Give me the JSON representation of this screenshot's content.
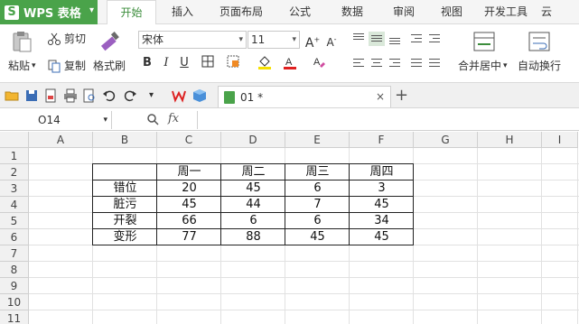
{
  "app": {
    "logo": "S",
    "name": "WPS 表格",
    "caret": "▾"
  },
  "menu": {
    "tabs": [
      {
        "label": "开始"
      },
      {
        "label": "插入"
      },
      {
        "label": "页面布局"
      },
      {
        "label": "公式"
      },
      {
        "label": "数据"
      },
      {
        "label": "审阅"
      },
      {
        "label": "视图"
      },
      {
        "label": "开发工具"
      },
      {
        "label": "云"
      }
    ]
  },
  "ribbon": {
    "paste": "粘贴",
    "cut": "剪切",
    "copy": "复制",
    "format_painter": "格式刷",
    "font_name": "宋体",
    "font_size": "11",
    "bold": "B",
    "italic": "I",
    "underline": "U",
    "merge_center": "合并居中",
    "wrap_text": "自动换行",
    "font_color": "#e02020",
    "fill_color": "#f5e000"
  },
  "quick_access": {
    "doc_tab": "01 *",
    "close": "×",
    "add": "+"
  },
  "formula_bar": {
    "cell_ref": "O14",
    "fx": "fx",
    "value": ""
  },
  "sheet": {
    "columns": [
      "A",
      "B",
      "C",
      "D",
      "E",
      "F",
      "G",
      "H",
      "I"
    ],
    "rows": [
      "1",
      "2",
      "3",
      "4",
      "5",
      "6",
      "7",
      "8",
      "9",
      "10",
      "11"
    ],
    "table": {
      "header": [
        "",
        "周一",
        "周二",
        "周三",
        "周四"
      ],
      "body": [
        [
          "错位",
          "20",
          "45",
          "6",
          "3"
        ],
        [
          "脏污",
          "45",
          "44",
          "7",
          "45"
        ],
        [
          "开裂",
          "66",
          "6",
          "6",
          "34"
        ],
        [
          "变形",
          "77",
          "88",
          "45",
          "45"
        ]
      ]
    }
  },
  "colors": {
    "accent": "#4aa34a",
    "tab_active_text": "#3c8d3c"
  }
}
